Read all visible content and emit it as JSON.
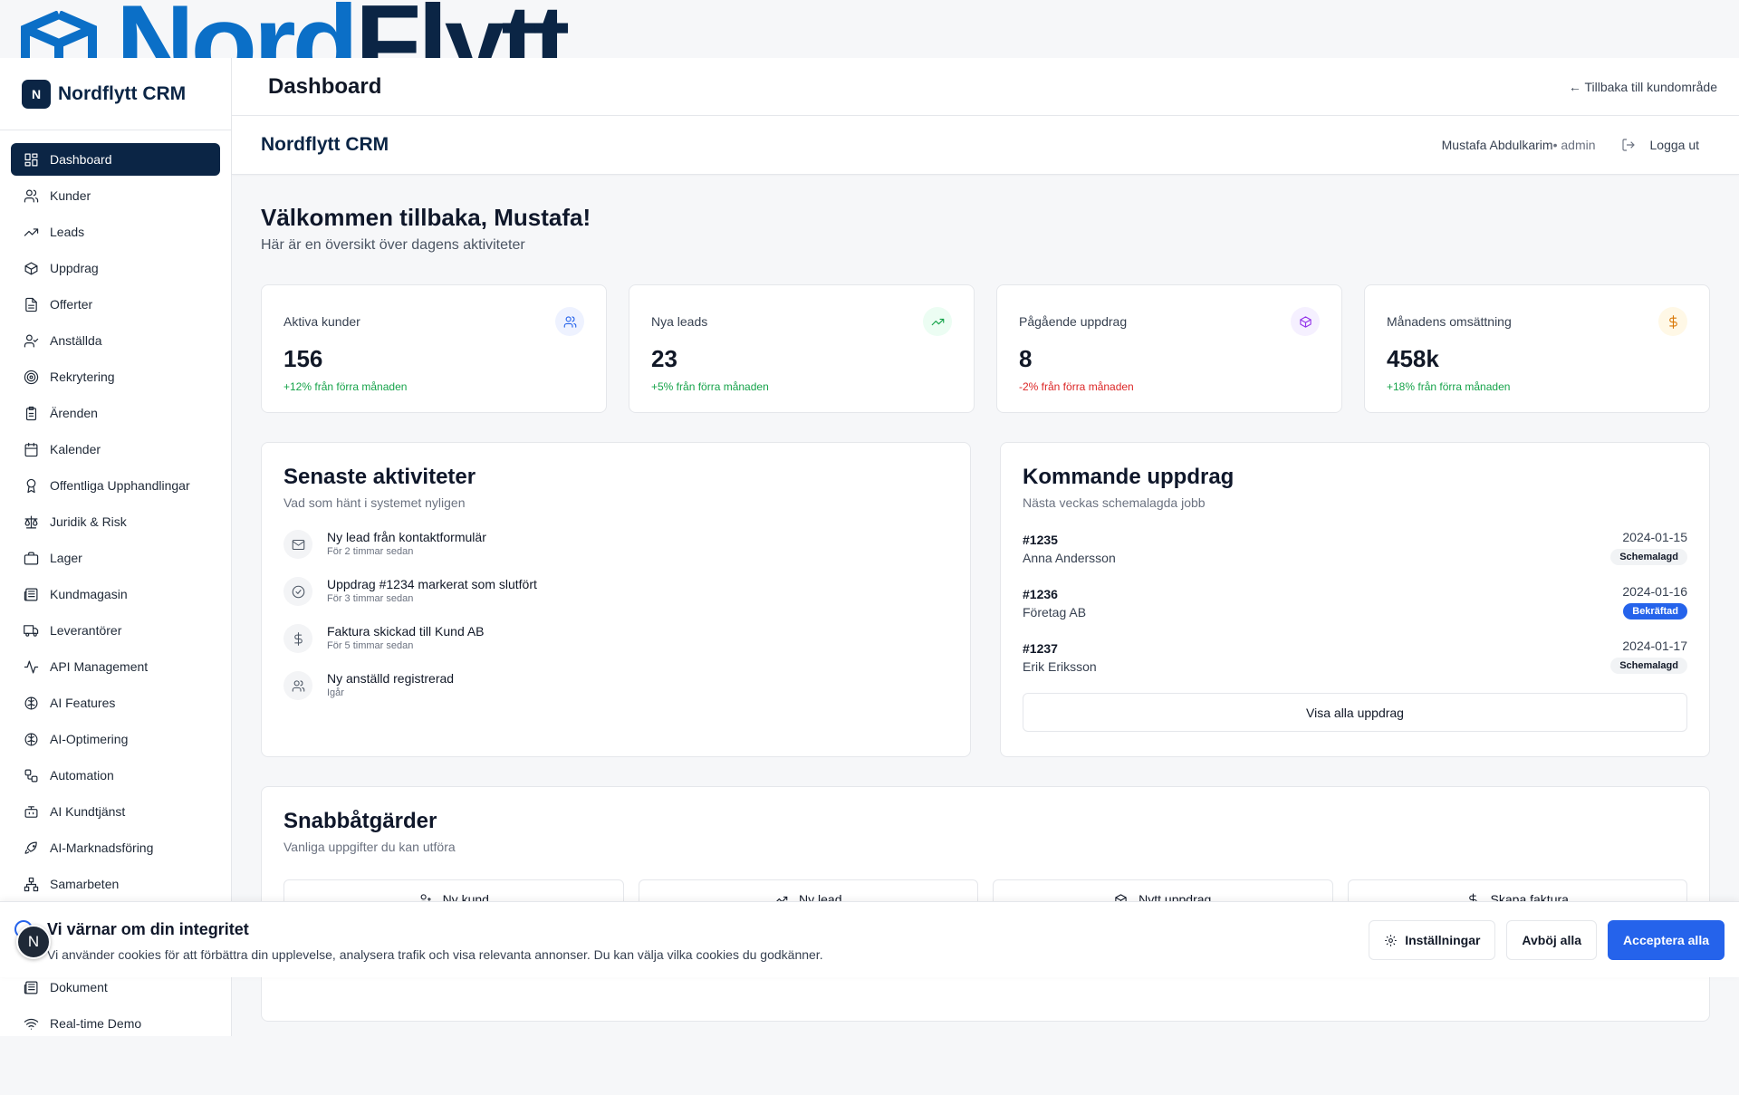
{
  "top_logo": {
    "text_part1": "Nord",
    "text_part2": "Flytt"
  },
  "sidebar": {
    "brand_badge": "N",
    "brand_name": "Nordflytt CRM",
    "items": [
      {
        "label": "Dashboard",
        "icon": "dashboard-icon",
        "active": true
      },
      {
        "label": "Kunder",
        "icon": "users-icon"
      },
      {
        "label": "Leads",
        "icon": "trending-up-icon"
      },
      {
        "label": "Uppdrag",
        "icon": "package-icon"
      },
      {
        "label": "Offerter",
        "icon": "file-text-icon"
      },
      {
        "label": "Anställda",
        "icon": "user-check-icon"
      },
      {
        "label": "Rekrytering",
        "icon": "target-icon"
      },
      {
        "label": "Ärenden",
        "icon": "clipboard-icon"
      },
      {
        "label": "Kalender",
        "icon": "calendar-icon"
      },
      {
        "label": "Offentliga Upphandlingar",
        "icon": "award-icon"
      },
      {
        "label": "Juridik & Risk",
        "icon": "scale-icon"
      },
      {
        "label": "Lager",
        "icon": "briefcase-icon"
      },
      {
        "label": "Kundmagasin",
        "icon": "newspaper-icon"
      },
      {
        "label": "Leverantörer",
        "icon": "truck-icon"
      },
      {
        "label": "API Management",
        "icon": "activity-icon"
      },
      {
        "label": "AI Features",
        "icon": "brain-icon"
      },
      {
        "label": "AI-Optimering",
        "icon": "brain-icon"
      },
      {
        "label": "Automation",
        "icon": "workflow-icon"
      },
      {
        "label": "AI Kundtjänst",
        "icon": "bot-icon"
      },
      {
        "label": "AI-Marknadsföring",
        "icon": "rocket-icon"
      },
      {
        "label": "Samarbeten",
        "icon": "network-icon"
      }
    ],
    "lower_items": [
      {
        "label": "Dokument",
        "icon": "newspaper-icon"
      },
      {
        "label": "Real-time Demo",
        "icon": "wifi-icon"
      }
    ]
  },
  "header": {
    "title": "Dashboard",
    "back_link": "← Tillbaka till kundområde"
  },
  "subheader": {
    "brand": "Nordflytt CRM",
    "user_name": "Mustafa Abdulkarim",
    "user_role": " • admin",
    "logout": "Logga ut"
  },
  "welcome": {
    "title": "Välkommen tillbaka, Mustafa!",
    "subtitle": "Här är en översikt över dagens aktiviteter"
  },
  "stats": [
    {
      "label": "Aktiva kunder",
      "value": "156",
      "change": "+12% från förra månaden",
      "trend": "pos",
      "icon": "users-icon",
      "icon_color": "#2563eb",
      "icon_bg": "#eef2ff"
    },
    {
      "label": "Nya leads",
      "value": "23",
      "change": "+5% från förra månaden",
      "trend": "pos",
      "icon": "trending-up-icon",
      "icon_color": "#16a34a",
      "icon_bg": "#ecfdf3"
    },
    {
      "label": "Pågående uppdrag",
      "value": "8",
      "change": "-2% från förra månaden",
      "trend": "neg",
      "icon": "package-icon",
      "icon_color": "#9333ea",
      "icon_bg": "#f5f0ff"
    },
    {
      "label": "Månadens omsättning",
      "value": "458k",
      "change": "+18% från förra månaden",
      "trend": "pos",
      "icon": "dollar-icon",
      "icon_color": "#d97706",
      "icon_bg": "#fff8e6"
    }
  ],
  "activities": {
    "title": "Senaste aktiviteter",
    "subtitle": "Vad som hänt i systemet nyligen",
    "items": [
      {
        "title": "Ny lead från kontaktformulär",
        "time": "För 2 timmar sedan",
        "icon": "mail-icon"
      },
      {
        "title": "Uppdrag #1234 markerat som slutfört",
        "time": "För 3 timmar sedan",
        "icon": "check-circle-icon"
      },
      {
        "title": "Faktura skickad till Kund AB",
        "time": "För 5 timmar sedan",
        "icon": "dollar-icon"
      },
      {
        "title": "Ny anställd registrerad",
        "time": "Igår",
        "icon": "users-icon"
      }
    ]
  },
  "upcoming": {
    "title": "Kommande uppdrag",
    "subtitle": "Nästa veckas schemalagda jobb",
    "jobs": [
      {
        "id": "#1235",
        "name": "Anna Andersson",
        "date": "2024-01-15",
        "status": "Schemalagd",
        "style": "grey"
      },
      {
        "id": "#1236",
        "name": "Företag AB",
        "date": "2024-01-16",
        "status": "Bekräftad",
        "style": "blue"
      },
      {
        "id": "#1237",
        "name": "Erik Eriksson",
        "date": "2024-01-17",
        "status": "Schemalagd",
        "style": "grey"
      }
    ],
    "button": "Visa alla uppdrag"
  },
  "quick": {
    "title": "Snabbåtgärder",
    "subtitle": "Vanliga uppgifter du kan utföra",
    "actions": [
      {
        "label": "Ny kund",
        "icon": "user-plus-icon"
      },
      {
        "label": "Ny lead",
        "icon": "trending-up-icon"
      },
      {
        "label": "Nytt uppdrag",
        "icon": "package-icon"
      },
      {
        "label": "Skapa faktura",
        "icon": "dollar-icon"
      }
    ]
  },
  "cookie": {
    "title": "Vi värnar om din integritet",
    "text": "Vi använder cookies för att förbättra din upplevelse, analysera trafik och visa relevanta annonser. Du kan välja vilka cookies du godkänner.",
    "settings": "Inställningar",
    "reject": "Avböj alla",
    "accept": "Acceptera alla",
    "fab_letter": "N"
  }
}
